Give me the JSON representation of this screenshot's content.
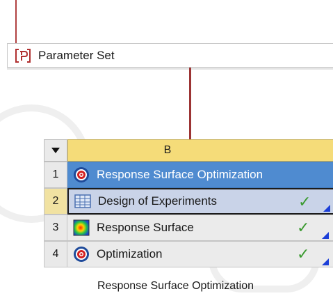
{
  "parameter_set": {
    "label": "Parameter Set",
    "icon": "parameter-set-icon"
  },
  "system": {
    "column_header": "B",
    "menu_icon": "dropdown-triangle-icon",
    "rows": [
      {
        "num": "1",
        "label": "Response Surface Optimization",
        "icon": "target-icon",
        "status": ""
      },
      {
        "num": "2",
        "label": "Design of Experiments",
        "icon": "table-grid-icon",
        "status": "✓"
      },
      {
        "num": "3",
        "label": "Response Surface",
        "icon": "surface-plot-icon",
        "status": "✓"
      },
      {
        "num": "4",
        "label": "Optimization",
        "icon": "target-icon",
        "status": "✓"
      }
    ],
    "caption": "Response Surface Optimization"
  },
  "colors": {
    "title_row": "#4f8bd0",
    "header": "#f5dc79",
    "connector": "#9c3434",
    "check": "#3a9a2f",
    "corner_marker": "#1c3fd8"
  }
}
